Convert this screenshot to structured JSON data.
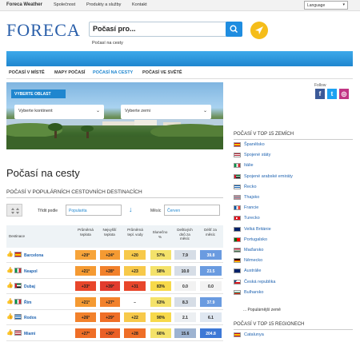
{
  "topbar": {
    "brand": "Foreca Weather",
    "links": [
      "Společnost",
      "Produkty a služby",
      "Kontakt"
    ],
    "language": "Language"
  },
  "header": {
    "logo": "FORECA",
    "search_value": "Počasí pro...",
    "sub_link": "Počasí na cesty"
  },
  "nav": {
    "items": [
      "POČASÍ V MÍSTĚ",
      "MAPY POČASÍ",
      "POČASÍ NA CESTY",
      "POČASÍ VE SVĚTĚ"
    ],
    "active_index": 2
  },
  "hero": {
    "tag": "VYBERTE OBLAST",
    "continent_placeholder": "Vyberte kontinent",
    "country_placeholder": "Vyberte zemi"
  },
  "main": {
    "page_title": "Počasí na cesty",
    "section_title": "POČASÍ V POPULÁRNÍCH CESTOVNÍCH DESTINACÍCH",
    "sort_label": "Třídit podle",
    "sort_value": "Popularita",
    "month_label": "Měsíc",
    "month_value": "Červen"
  },
  "table": {
    "headers": [
      "Destinace",
      "Průměrná teplota",
      "Nejvyšší teplota",
      "Průměrná tepl. vody",
      "Slunečno %",
      "Deštivých dnů za měsíc",
      "Déšť za měsíc"
    ],
    "rows": [
      {
        "city": "Barcelona",
        "flag": "spain",
        "values": [
          "+20°",
          "+24°",
          "+20",
          "57%",
          "7.9",
          "39.8"
        ],
        "colors": [
          "#f7a43a",
          "#f59a32",
          "#f7c94a",
          "#f4e26a",
          "#d6dde6",
          "#6a9be0"
        ]
      },
      {
        "city": "Neapol",
        "flag": "italy",
        "values": [
          "+21°",
          "+28°",
          "+23",
          "58%",
          "10.0",
          "23.5"
        ],
        "colors": [
          "#f59a32",
          "#f2812b",
          "#f7c94a",
          "#f4e26a",
          "#d6dde6",
          "#6a9be0"
        ]
      },
      {
        "city": "Dubaj",
        "flag": "uae",
        "values": [
          "+33°",
          "+39°",
          "+31",
          "83%",
          "0.0",
          "0.0"
        ],
        "colors": [
          "#e8462b",
          "#e23b2e",
          "#e8462b",
          "#f7d94a",
          "#f2f2f2",
          "#f2f2f2"
        ]
      },
      {
        "city": "Řím",
        "flag": "italy",
        "values": [
          "+21°",
          "+27°",
          "–",
          "63%",
          "8.3",
          "37.9"
        ],
        "colors": [
          "#f59a32",
          "#f2812b",
          "#ffffff",
          "#f4e26a",
          "#d6dde6",
          "#6a9be0"
        ]
      },
      {
        "city": "Rodos",
        "flag": "greece",
        "values": [
          "+26°",
          "+29°",
          "+22",
          "90%",
          "2.1",
          "6.1"
        ],
        "colors": [
          "#f2812b",
          "#ef6e27",
          "#f7c94a",
          "#f7d94a",
          "#eceff2",
          "#dfe7f1"
        ]
      },
      {
        "city": "Miami",
        "flag": "usa",
        "values": [
          "+27°",
          "+30°",
          "+28",
          "66%",
          "15.6",
          "204.8"
        ],
        "colors": [
          "#ef6e27",
          "#ea5f26",
          "#ef6e27",
          "#f4e26a",
          "#9db3d1",
          "#3d78d6"
        ]
      }
    ]
  },
  "sidebar": {
    "follow": "Follow",
    "social": [
      "f",
      "t",
      "ig"
    ],
    "top_countries_title": "POČASÍ V TOP 15 ZEMÍCH",
    "countries": [
      {
        "name": "Španělsko",
        "flag": "spain"
      },
      {
        "name": "Spojené státy",
        "flag": "usa"
      },
      {
        "name": "Itálie",
        "flag": "italy"
      },
      {
        "name": "Spojené arabské emiráty",
        "flag": "uae"
      },
      {
        "name": "Řecko",
        "flag": "greece"
      },
      {
        "name": "Thajsko",
        "flag": "thailand"
      },
      {
        "name": "Francie",
        "flag": "france"
      },
      {
        "name": "Turecko",
        "flag": "turkey"
      },
      {
        "name": "Velká Británie",
        "flag": "uk"
      },
      {
        "name": "Portugalsko",
        "flag": "portugal"
      },
      {
        "name": "Maďarsko",
        "flag": "hungary"
      },
      {
        "name": "Německo",
        "flag": "germany"
      },
      {
        "name": "Austrálie",
        "flag": "australia"
      },
      {
        "name": "Česká republika",
        "flag": "czech"
      },
      {
        "name": "Bulharsko",
        "flag": "bulgaria"
      }
    ],
    "more_countries": "... Populárnější země",
    "top_regions_title": "POČASÍ V TOP 15 REGIONECH",
    "regions": [
      {
        "name": "Catalunya",
        "flag": "spain"
      }
    ]
  }
}
